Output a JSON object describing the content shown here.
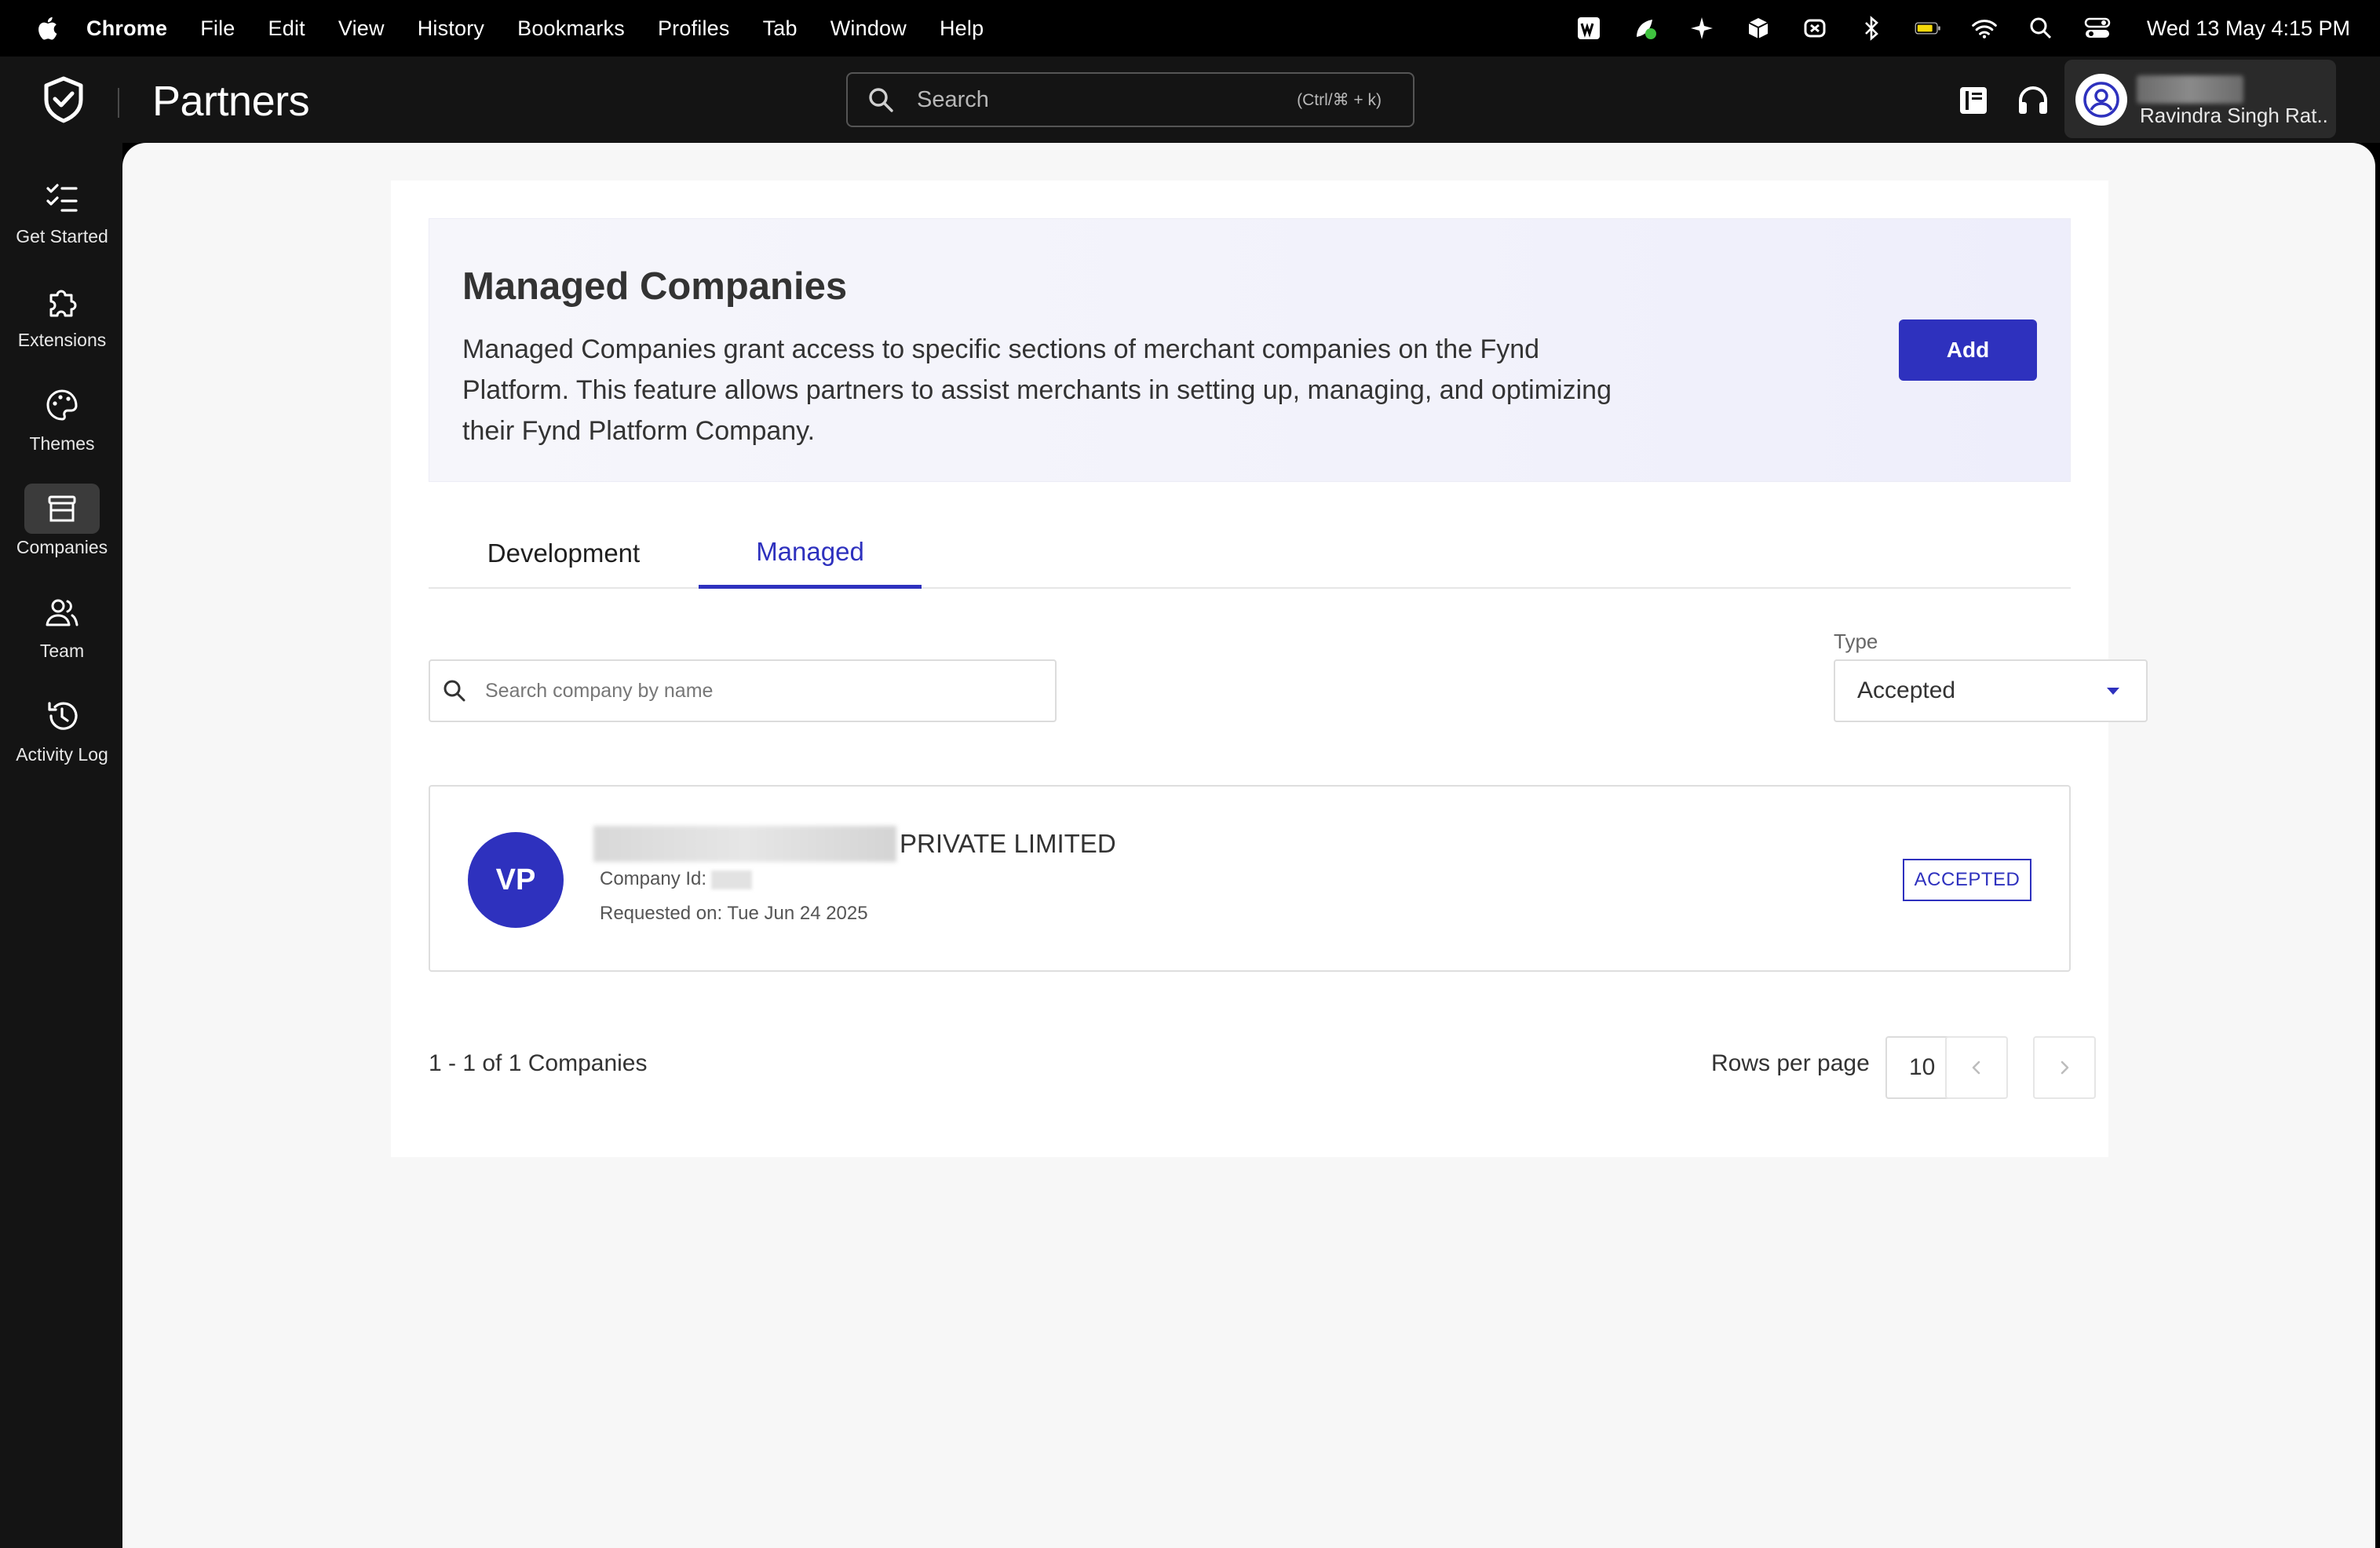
{
  "menubar": {
    "app_name": "Chrome",
    "items": [
      "File",
      "Edit",
      "View",
      "History",
      "Bookmarks",
      "Profiles",
      "Tab",
      "Window",
      "Help"
    ],
    "clock": "Wed 13 May  4:15 PM",
    "tray_icons": [
      "w-app-icon",
      "leaf-icon",
      "sparkle-icon",
      "cube-icon",
      "headset-app-icon",
      "bluetooth-icon",
      "battery-icon",
      "wifi-icon",
      "spotlight-search-icon",
      "control-center-icon"
    ]
  },
  "header": {
    "brand": "Partners",
    "search_placeholder": "Search",
    "search_shortcut": "(Ctrl/⌘ + k)",
    "user_name": "Ravindra Singh Rat..."
  },
  "sidebar": {
    "items": [
      {
        "label": "Get Started",
        "icon": "checklist-icon"
      },
      {
        "label": "Extensions",
        "icon": "puzzle-icon"
      },
      {
        "label": "Themes",
        "icon": "palette-icon"
      },
      {
        "label": "Companies",
        "icon": "store-icon",
        "active": true
      },
      {
        "label": "Team",
        "icon": "people-icon"
      },
      {
        "label": "Activity Log",
        "icon": "history-icon"
      }
    ]
  },
  "banner": {
    "title": "Managed Companies",
    "description": "Managed Companies grant access to specific sections of merchant companies on the Fynd Platform. This feature allows partners to assist merchants in setting up, managing, and optimizing their Fynd Platform Company.",
    "add_label": "Add"
  },
  "tabs": [
    {
      "label": "Development"
    },
    {
      "label": "Managed",
      "active": true
    }
  ],
  "filters": {
    "search_placeholder": "Search company by name",
    "type_label": "Type",
    "type_value": "Accepted"
  },
  "companies": [
    {
      "initials": "VP",
      "name_suffix": "PRIVATE LIMITED",
      "company_id_label": "Company Id:",
      "requested_on": "Requested on: Tue Jun 24 2025",
      "status": "ACCEPTED"
    }
  ],
  "pagination": {
    "summary": "1 - 1 of 1 Companies",
    "rows_label": "Rows per page",
    "rows_value": "10"
  },
  "colors": {
    "accent": "#2e31be",
    "chrome_dark": "#141414",
    "page_bg": "#f7f7f7"
  }
}
